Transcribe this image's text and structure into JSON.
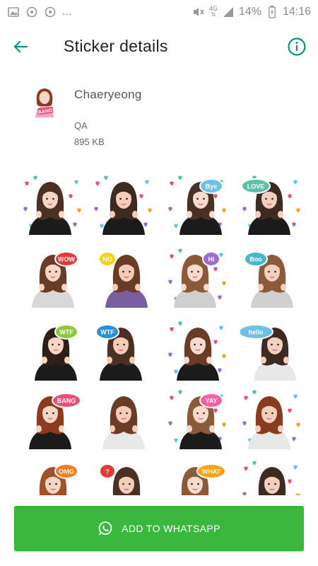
{
  "status_bar": {
    "dots": "...",
    "network": "4G",
    "battery": "14%",
    "time": "14:16"
  },
  "app_bar": {
    "title": "Sticker details"
  },
  "pack": {
    "name": "Chaeryeong",
    "publisher": "QA",
    "size": "895 KB",
    "tray_text": "BANG"
  },
  "stickers": [
    {
      "bubble": "",
      "bubble_color": "#e94e77",
      "hearts": true,
      "hair": "#4a3025",
      "top": "#1b1b1b"
    },
    {
      "bubble": "",
      "bubble_color": "#e94e77",
      "hearts": true,
      "hair": "#3d2a20",
      "top": "#1b1b1b"
    },
    {
      "bubble": "Bye",
      "bubble_color": "#6dc0e8",
      "hearts": true,
      "hair": "#4a3025",
      "top": "#1b1b1b"
    },
    {
      "bubble": "LOVE",
      "bubble_color": "#5bc0a8",
      "hearts": true,
      "hair": "#3d2a20",
      "top": "#1b1b1b"
    },
    {
      "bubble": "WOW",
      "bubble_color": "#e53935",
      "hearts": false,
      "hair": "#6a3b25",
      "top": "#d8d8d8"
    },
    {
      "bubble": "NO",
      "bubble_color": "#f6d21b",
      "hearts": false,
      "hair": "#6a3b25",
      "top": "#7a5fa0"
    },
    {
      "bubble": "Hi",
      "bubble_color": "#9c6ad0",
      "hearts": true,
      "hair": "#8a5a3a",
      "top": "#cfcfcf"
    },
    {
      "bubble": "Boo",
      "bubble_color": "#45b7c9",
      "hearts": false,
      "hair": "#8a5a3a",
      "top": "#d0d0d0"
    },
    {
      "bubble": "WTF",
      "bubble_color": "#8dc63f",
      "hearts": false,
      "hair": "#2e1f18",
      "top": "#1b1b1b"
    },
    {
      "bubble": "WTF",
      "bubble_color": "#2a8fd8",
      "hearts": false,
      "hair": "#4a3025",
      "top": "#1b1b1b"
    },
    {
      "bubble": "",
      "bubble_color": "#e94e77",
      "hearts": true,
      "hair": "#6a3b25",
      "top": "#1b1b1b"
    },
    {
      "bubble": "hello",
      "bubble_color": "#6dc0e8",
      "hearts": false,
      "hair": "#3d2a20",
      "top": "#e8e8e8"
    },
    {
      "bubble": "BANG",
      "bubble_color": "#e94e77",
      "hearts": false,
      "hair": "#8a3b20",
      "top": "#1b1b1b"
    },
    {
      "bubble": "",
      "bubble_color": "#e94e77",
      "hearts": false,
      "hair": "#6a3b25",
      "top": "#e8e8e8"
    },
    {
      "bubble": "YAY",
      "bubble_color": "#ff5fa2",
      "hearts": true,
      "hair": "#8a5a3a",
      "top": "#1b1b1b"
    },
    {
      "bubble": "",
      "bubble_color": "#e94e77",
      "hearts": true,
      "hair": "#8a3b20",
      "top": "#e8e8e8"
    },
    {
      "bubble": "OMG",
      "bubble_color": "#f57c20",
      "hearts": false,
      "hair": "#a0502a",
      "top": "#1b1b1b"
    },
    {
      "bubble": "?",
      "bubble_color": "#e53935",
      "hearts": false,
      "hair": "#4a3025",
      "top": "#1b1b1b"
    },
    {
      "bubble": "WHAT",
      "bubble_color": "#f6a21b",
      "hearts": false,
      "hair": "#8a5a3a",
      "top": "#e8e8e8"
    },
    {
      "bubble": "",
      "bubble_color": "#e94e77",
      "hearts": true,
      "hair": "#3d2a20",
      "top": "#2a2a4a"
    }
  ],
  "add_button": {
    "label": "ADD TO WHATSAPP"
  },
  "colors": {
    "accent": "#0f8f80",
    "button": "#3bb73d"
  }
}
